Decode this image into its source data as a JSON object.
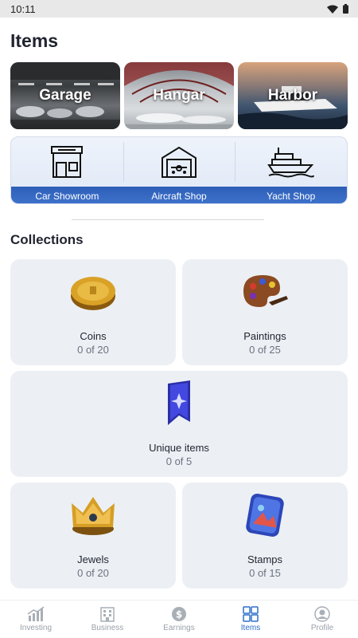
{
  "status_bar": {
    "time": "10:11"
  },
  "page": {
    "title": "Items"
  },
  "places": [
    {
      "label": "Garage"
    },
    {
      "label": "Hangar"
    },
    {
      "label": "Harbor"
    }
  ],
  "shops": [
    {
      "label": "Car Showroom",
      "icon": "car-showroom-icon"
    },
    {
      "label": "Aircraft Shop",
      "icon": "aircraft-shop-icon"
    },
    {
      "label": "Yacht Shop",
      "icon": "yacht-shop-icon"
    }
  ],
  "collections": {
    "title": "Collections",
    "items": [
      {
        "name": "Coins",
        "count": "0 of 20",
        "icon": "coin-icon"
      },
      {
        "name": "Paintings",
        "count": "0 of 25",
        "icon": "palette-icon"
      },
      {
        "name": "Unique items",
        "count": "0 of 5",
        "icon": "unique-badge-icon"
      },
      {
        "name": "Jewels",
        "count": "0 of 20",
        "icon": "crown-icon"
      },
      {
        "name": "Stamps",
        "count": "0 of 15",
        "icon": "stamp-icon"
      }
    ]
  },
  "nav": {
    "items": [
      {
        "label": "Investing",
        "icon": "chart-icon"
      },
      {
        "label": "Business",
        "icon": "building-icon"
      },
      {
        "label": "Earnings",
        "icon": "dollar-icon"
      },
      {
        "label": "Items",
        "icon": "grid-icon",
        "active": true
      },
      {
        "label": "Profile",
        "icon": "user-icon"
      }
    ]
  },
  "colors": {
    "accent": "#2f6ec8",
    "card": "#ecf0f4",
    "shop_bar": "#2e5fb8"
  }
}
